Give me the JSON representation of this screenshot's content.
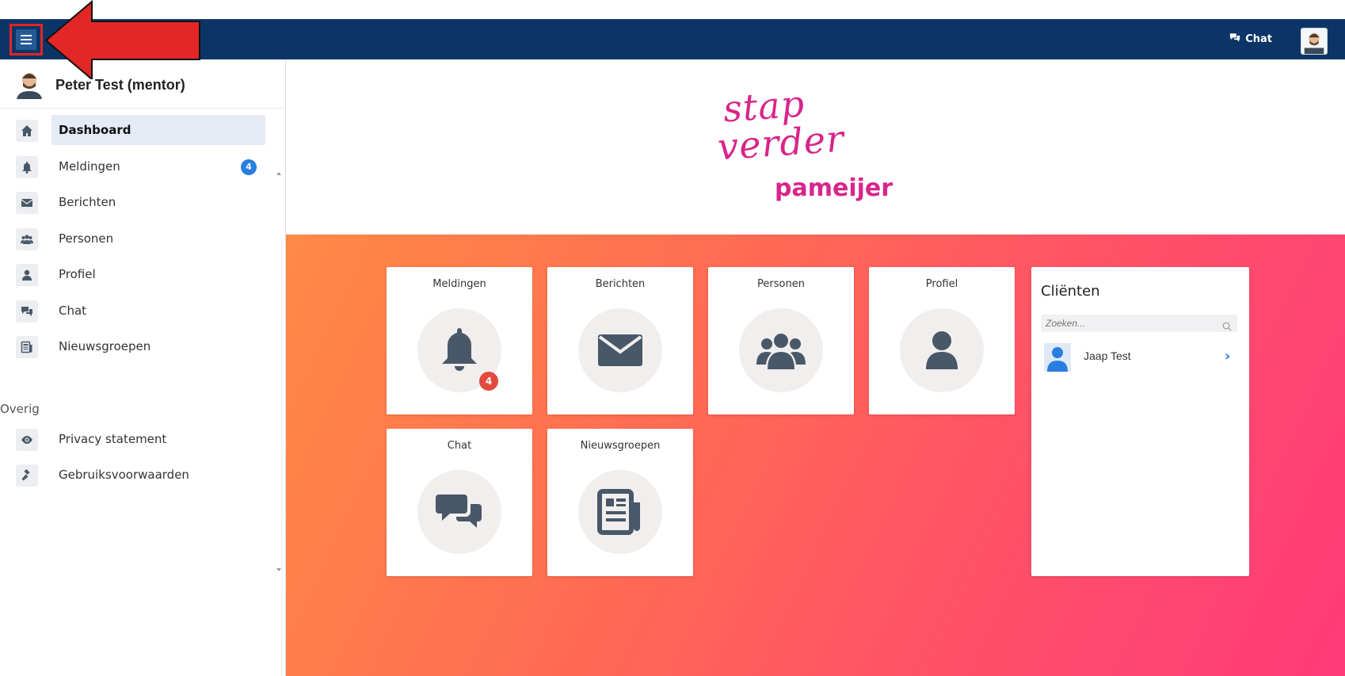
{
  "topbar": {
    "menu_icon": "hamburger-icon",
    "chat_label": "Chat",
    "chat_icon": "chat-bubbles-icon",
    "avatar_icon": "user-avatar-icon",
    "bg_color": "#0c3567"
  },
  "sidebar": {
    "user_name": "Peter Test (mentor)",
    "items": [
      {
        "label": "Dashboard",
        "icon": "home-icon",
        "active": true
      },
      {
        "label": "Meldingen",
        "icon": "bell-icon",
        "badge": "4"
      },
      {
        "label": "Berichten",
        "icon": "envelope-icon"
      },
      {
        "label": "Personen",
        "icon": "users-icon"
      },
      {
        "label": "Profiel",
        "icon": "user-icon"
      },
      {
        "label": "Chat",
        "icon": "chat-icon"
      },
      {
        "label": "Nieuwsgroepen",
        "icon": "newspaper-icon"
      }
    ],
    "section_other": "Overig",
    "other_items": [
      {
        "label": "Privacy statement",
        "icon": "eye-icon"
      },
      {
        "label": "Gebruiksvoorwaarden",
        "icon": "gavel-icon"
      }
    ]
  },
  "logo": {
    "line1": "stap",
    "line2": "verder",
    "line3": "pameijer",
    "color": "#d8258a"
  },
  "tiles": [
    {
      "title": "Meldingen",
      "icon": "bell-icon",
      "badge": "4"
    },
    {
      "title": "Berichten",
      "icon": "envelope-icon"
    },
    {
      "title": "Personen",
      "icon": "users-icon"
    },
    {
      "title": "Profiel",
      "icon": "user-icon"
    },
    {
      "title": "Chat",
      "icon": "chat-icon"
    },
    {
      "title": "Nieuwsgroepen",
      "icon": "newspaper-icon"
    }
  ],
  "clients": {
    "title": "Cliënten",
    "search_placeholder": "Zoeken...",
    "list": [
      {
        "name": "Jaap Test"
      }
    ]
  },
  "colors": {
    "accent_blue": "#2a7de1",
    "badge_red": "#e34a3e",
    "icon_dark": "#485868"
  }
}
